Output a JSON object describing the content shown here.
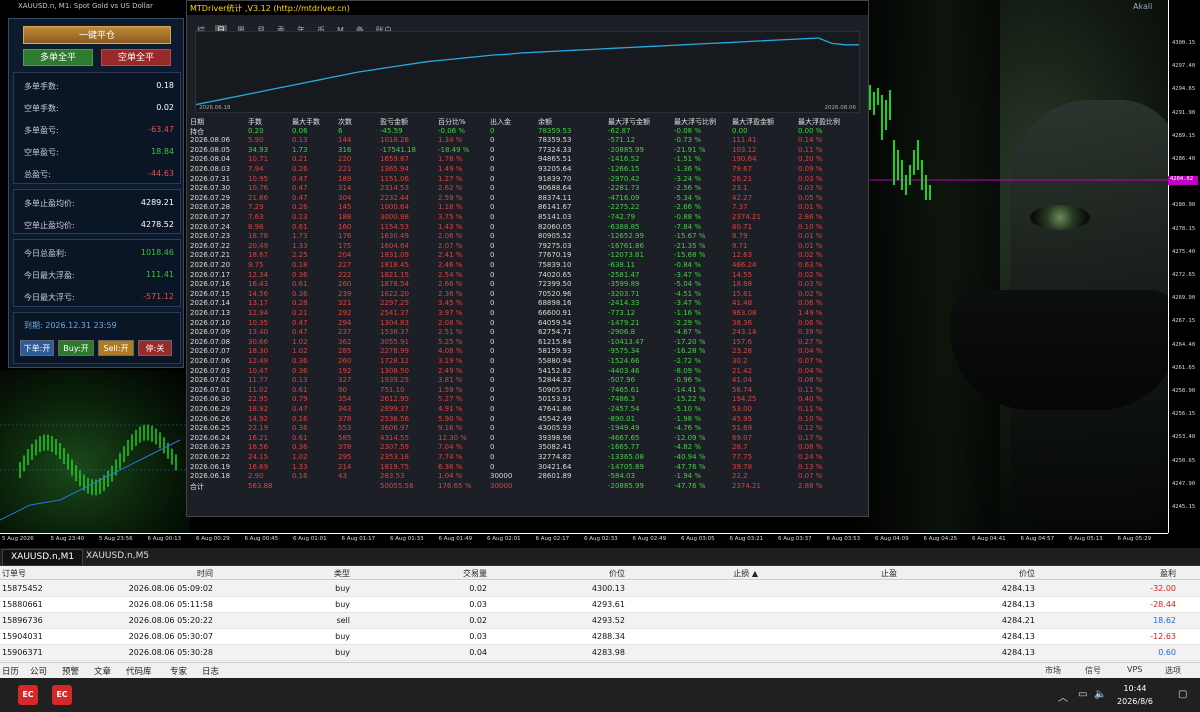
{
  "chart": {
    "title": "XAUUSD.n, M1:  Spot Gold vs US Dollar",
    "user": "Akali",
    "current_price": "4284.62",
    "price_ticks": [
      "4300.15",
      "4297.40",
      "4294.65",
      "4291.90",
      "4289.15",
      "4286.40",
      "4283.65",
      "4280.90",
      "4278.15",
      "4275.40",
      "4272.65",
      "4269.90",
      "4267.15",
      "4264.40",
      "4261.65",
      "4258.90",
      "4256.15",
      "4253.40",
      "4250.65",
      "4247.90",
      "4245.15"
    ],
    "time_ticks": [
      "5 Aug 2026",
      "5 Aug 23:40",
      "5 Aug 23:56",
      "6 Aug 00:13",
      "6 Aug 00:29",
      "6 Aug 00:45",
      "6 Aug 01:01",
      "6 Aug 01:17",
      "6 Aug 01:33",
      "6 Aug 01:49",
      "6 Aug 02:01",
      "6 Aug 02:17",
      "6 Aug 02:33",
      "6 Aug 02:49",
      "6 Aug 03:05",
      "6 Aug 03:21",
      "6 Aug 03:37",
      "6 Aug 03:53",
      "6 Aug 04:09",
      "6 Aug 04:25",
      "6 Aug 04:41",
      "6 Aug 04:57",
      "6 Aug 05:13",
      "6 Aug 05:29"
    ],
    "tabs": [
      "XAUUSD.n,M1",
      "XAUUSD.n,M5"
    ]
  },
  "panel": {
    "close_all": "一键平仓",
    "long_close": "多单全平",
    "short_close": "空单全平",
    "stats1": [
      {
        "label": "多单手数:",
        "value": "0.18",
        "color": "#ffffff"
      },
      {
        "label": "空单手数:",
        "value": "0.02",
        "color": "#ffffff"
      },
      {
        "label": "多单盈亏:",
        "value": "-63.47",
        "color": "#e05050"
      },
      {
        "label": "空单盈亏:",
        "value": "18.84",
        "color": "#40c040"
      },
      {
        "label": "总盈亏:",
        "value": "-44.63",
        "color": "#e05050"
      }
    ],
    "stats2": [
      {
        "label": "多单止盈均价:",
        "value": "4289.21",
        "color": "#ffffff"
      },
      {
        "label": "空单止盈均价:",
        "value": "4278.52",
        "color": "#ffffff"
      }
    ],
    "stats3": [
      {
        "label": "今日总盈利:",
        "value": "1018.46",
        "color": "#40c040"
      },
      {
        "label": "今日最大浮盈:",
        "value": "111.41",
        "color": "#40c040"
      },
      {
        "label": "今日最大浮亏:",
        "value": "-571.12",
        "color": "#e05050"
      }
    ],
    "expiry": "到期: 2026.12.31 23:59",
    "buttons": [
      {
        "label": "下单:开",
        "bg": "#2c5c9a"
      },
      {
        "label": "Buy:开",
        "bg": "#2c7a2c"
      },
      {
        "label": "Sell:开",
        "bg": "#b07a20"
      },
      {
        "label": "停:关",
        "bg": "#9a2a2a"
      }
    ]
  },
  "mtd": {
    "title": "MTDriver统计 ,V3.12 (http://mtdriver.cn)",
    "tabs": [
      "综",
      "日",
      "周",
      "月",
      "季",
      "年",
      "币",
      "M",
      "备",
      "账户"
    ],
    "active_tab": 1,
    "equity_start": "2026.06.18",
    "equity_end": "2026.08.06",
    "equity_curve": [
      0.02,
      0.06,
      0.1,
      0.14,
      0.18,
      0.22,
      0.26,
      0.3,
      0.34,
      0.38,
      0.42,
      0.46,
      0.5,
      0.53,
      0.56,
      0.59,
      0.62,
      0.65,
      0.67,
      0.69,
      0.71,
      0.73,
      0.75,
      0.76,
      0.78,
      0.79,
      0.8,
      0.81,
      0.82,
      0.83,
      0.84,
      0.85,
      0.86,
      0.87,
      0.88,
      0.89,
      0.9,
      0.91,
      0.92,
      0.93,
      0.94,
      0.95,
      0.96,
      0.97,
      0.98,
      0.99,
      1.0,
      0.92,
      0.9,
      0.9
    ],
    "headers": [
      "日期",
      "手数",
      "最大手数",
      "次数",
      "盈亏金额",
      "百分比%",
      "出入金",
      "余额",
      "最大浮亏金额",
      "最大浮亏比例",
      "最大浮盈金额",
      "最大浮盈比例"
    ],
    "hold": [
      "持仓",
      "0.20",
      "0.06",
      "6",
      "-45.59",
      "-0.06 %",
      "0",
      "78359.53",
      "-62.87",
      "-0.08 %",
      "0.00",
      "0.00 %"
    ],
    "rows": [
      [
        "2026.08.06",
        "5.90",
        "0.13",
        "144",
        "1018.26",
        "1.34 %",
        "0",
        "78359.53",
        "-571.12",
        "-0.73 %",
        "111.41",
        "0.14 %"
      ],
      [
        "2026.08.05",
        "34.93",
        "1.73",
        "316",
        "-17541.18",
        "-18.49 %",
        "0",
        "77324.33",
        "-20885.99",
        "-21.91 %",
        "103.12",
        "0.11 %"
      ],
      [
        "2026.08.04",
        "10.71",
        "0.21",
        "220",
        "1659.87",
        "1.78 %",
        "0",
        "94865.51",
        "-1416.52",
        "-1.51 %",
        "190.64",
        "0.20 %"
      ],
      [
        "2026.08.03",
        "7.94",
        "0.26",
        "221",
        "1365.94",
        "1.49 %",
        "0",
        "93205.64",
        "-1266.15",
        "-1.36 %",
        "79.67",
        "0.09 %"
      ],
      [
        "2026.07.31",
        "10.95",
        "0.47",
        "189",
        "1151.06",
        "1.27 %",
        "0",
        "91839.70",
        "-2970.42",
        "-3.24 %",
        "26.21",
        "0.03 %"
      ],
      [
        "2026.07.30",
        "10.76",
        "0.47",
        "314",
        "2314.53",
        "2.62 %",
        "0",
        "90688.64",
        "-2281.73",
        "-2.56 %",
        "23.1",
        "0.03 %"
      ],
      [
        "2026.07.29",
        "21.66",
        "0.47",
        "304",
        "2232.44",
        "2.59 %",
        "0",
        "88374.11",
        "-4716.09",
        "-5.34 %",
        "42.27",
        "0.05 %"
      ],
      [
        "2026.07.28",
        "7.29",
        "0.26",
        "145",
        "1000.64",
        "1.18 %",
        "0",
        "86141.67",
        "-2275.22",
        "-2.66 %",
        "7.37",
        "0.01 %"
      ],
      [
        "2026.07.27",
        "7.63",
        "0.13",
        "188",
        "3000.98",
        "3.75 %",
        "0",
        "85141.03",
        "-742.79",
        "-0.88 %",
        "2374.21",
        "2.86 %"
      ],
      [
        "2026.07.24",
        "8.96",
        "0.61",
        "160",
        "1154.53",
        "1.43 %",
        "0",
        "82060.05",
        "-6388.85",
        "-7.84 %",
        "80.71",
        "0.10 %"
      ],
      [
        "2026.07.23",
        "18.78",
        "1.73",
        "176",
        "1630.49",
        "2.06 %",
        "0",
        "80905.52",
        "-12652.99",
        "-15.67 %",
        "8.79",
        "0.01 %"
      ],
      [
        "2026.07.22",
        "20.49",
        "1.33",
        "175",
        "1604.64",
        "2.07 %",
        "0",
        "79275.03",
        "-16761.86",
        "-21.35 %",
        "9.71",
        "0.01 %"
      ],
      [
        "2026.07.21",
        "18.67",
        "2.25",
        "204",
        "1831.09",
        "2.41 %",
        "0",
        "77670.19",
        "-12073.81",
        "-15.68 %",
        "12.63",
        "0.02 %"
      ],
      [
        "2026.07.20",
        "9.75",
        "0.18",
        "227",
        "1818.45",
        "2.46 %",
        "0",
        "75839.10",
        "-638.11",
        "-0.84 %",
        "466.24",
        "0.63 %"
      ],
      [
        "2026.07.17",
        "12.34",
        "0.36",
        "222",
        "1821.15",
        "2.54 %",
        "0",
        "74020.65",
        "-2581.47",
        "-3.47 %",
        "14.55",
        "0.02 %"
      ],
      [
        "2026.07.16",
        "16.43",
        "0.61",
        "260",
        "1878.54",
        "2.66 %",
        "0",
        "72399.50",
        "-3599.89",
        "-5.04 %",
        "18.68",
        "0.03 %"
      ],
      [
        "2026.07.15",
        "14.56",
        "0.36",
        "239",
        "1622.20",
        "2.36 %",
        "0",
        "70520.96",
        "-3203.71",
        "-4.51 %",
        "15.61",
        "0.02 %"
      ],
      [
        "2026.07.14",
        "13.17",
        "0.28",
        "321",
        "2297.25",
        "3.45 %",
        "0",
        "68898.16",
        "-2414.33",
        "-3.47 %",
        "41.48",
        "0.06 %"
      ],
      [
        "2026.07.13",
        "12.94",
        "0.21",
        "292",
        "2541.37",
        "3.97 %",
        "0",
        "66600.91",
        "-773.12",
        "-1.16 %",
        "963.08",
        "1.49 %"
      ],
      [
        "2026.07.10",
        "10.35",
        "0.47",
        "294",
        "1304.83",
        "2.08 %",
        "0",
        "64059.54",
        "-1479.21",
        "-2.29 %",
        "38.36",
        "0.06 %"
      ],
      [
        "2026.07.09",
        "13.40",
        "0.47",
        "237",
        "1538.37",
        "2.51 %",
        "0",
        "62754.71",
        "-2906.8",
        "-4.67 %",
        "243.14",
        "0.39 %"
      ],
      [
        "2026.07.08",
        "30.66",
        "1.02",
        "362",
        "3055.91",
        "5.25 %",
        "0",
        "61215.84",
        "-10413.47",
        "-17.20 %",
        "157.6",
        "0.27 %"
      ],
      [
        "2026.07.07",
        "18.30",
        "1.02",
        "285",
        "2278.99",
        "4.08 %",
        "0",
        "58159.93",
        "-9575.34",
        "-16.28 %",
        "23.28",
        "0.04 %"
      ],
      [
        "2026.07.06",
        "12.49",
        "0.36",
        "260",
        "1728.12",
        "3.19 %",
        "0",
        "55880.94",
        "-1524.66",
        "-2.72 %",
        "30.2",
        "0.07 %"
      ],
      [
        "2026.07.03",
        "10.47",
        "0.36",
        "192",
        "1308.50",
        "2.49 %",
        "0",
        "54152.82",
        "-4403.46",
        "-8.09 %",
        "21.42",
        "0.04 %"
      ],
      [
        "2026.07.02",
        "11.77",
        "0.13",
        "327",
        "1939.25",
        "3.81 %",
        "0",
        "52844.32",
        "-507.96",
        "-0.96 %",
        "41.04",
        "0.08 %"
      ],
      [
        "2026.07.01",
        "11.02",
        "0.61",
        "90",
        "751.10",
        "1.59 %",
        "0",
        "50905.07",
        "-7465.61",
        "-14.41 %",
        "56.74",
        "0.11 %"
      ],
      [
        "2026.06.30",
        "22.95",
        "0.79",
        "354",
        "2612.95",
        "5.27 %",
        "0",
        "50153.91",
        "-7486.3",
        "-15.22 %",
        "194.25",
        "0.40 %"
      ],
      [
        "2026.06.29",
        "18.92",
        "0.47",
        "343",
        "2899.37",
        "4.91 %",
        "0",
        "47641.86",
        "-2457.54",
        "-5.10 %",
        "53.00",
        "0.11 %"
      ],
      [
        "2026.06.26",
        "14.92",
        "0.16",
        "378",
        "2536.56",
        "5.90 %",
        "0",
        "45542.49",
        "-890.01",
        "-1.98 %",
        "45.95",
        "0.10 %"
      ],
      [
        "2026.06.25",
        "22.19",
        "0.36",
        "553",
        "3606.97",
        "9.16 %",
        "0",
        "43005.93",
        "-1949.49",
        "-4.76 %",
        "51.69",
        "0.12 %"
      ],
      [
        "2026.06.24",
        "16.21",
        "0.61",
        "585",
        "4314.55",
        "12.30 %",
        "0",
        "39398.96",
        "-4667.65",
        "-12.09 %",
        "69.07",
        "0.17 %"
      ],
      [
        "2026.06.23",
        "16.56",
        "0.36",
        "378",
        "2307.59",
        "7.04 %",
        "0",
        "35082.41",
        "-1665.77",
        "-4.82 %",
        "28.7",
        "0.08 %"
      ],
      [
        "2026.06.22",
        "24.15",
        "1.02",
        "295",
        "2353.18",
        "7.74 %",
        "0",
        "32774.82",
        "-13365.08",
        "-40.94 %",
        "77.75",
        "0.24 %"
      ],
      [
        "2026.06.19",
        "16.69",
        "1.33",
        "214",
        "1819.75",
        "6.36 %",
        "0",
        "30421.64",
        "-14705.89",
        "-47.76 %",
        "39.78",
        "0.13 %"
      ],
      [
        "2026.06.18",
        "2.90",
        "0.16",
        "43",
        "283.53",
        "1.04 %",
        "30000",
        "28601.89",
        "-584.03",
        "-1.94 %",
        "22.2",
        "0.07 %"
      ]
    ],
    "total": [
      "合计",
      "563.88",
      "",
      "",
      "50055.58",
      "176.65 %",
      "30000",
      "",
      "-20885.99",
      "-47.76 %",
      "2374.21",
      "2.88 %"
    ]
  },
  "orders": {
    "headers": [
      "订单号",
      "时间",
      "类型",
      "交易量",
      "价位",
      "止损 ▲",
      "止盈",
      "价位",
      "盈利"
    ],
    "rows": [
      {
        "id": "15875452",
        "time": "2026.08.06 05:09:02",
        "type": "buy",
        "vol": "0.02",
        "price": "4300.13",
        "sl": "",
        "tp": "",
        "cur": "4284.13",
        "profit": "-32.00",
        "pcolor": "#d02020"
      },
      {
        "id": "15880661",
        "time": "2026.08.06 05:11:58",
        "type": "buy",
        "vol": "0.03",
        "price": "4293.61",
        "sl": "",
        "tp": "",
        "cur": "4284.13",
        "profit": "-28.44",
        "pcolor": "#d02020"
      },
      {
        "id": "15896736",
        "time": "2026.08.06 05:20:22",
        "type": "sell",
        "vol": "0.02",
        "price": "4293.52",
        "sl": "",
        "tp": "",
        "cur": "4284.21",
        "profit": "18.62",
        "pcolor": "#1a6ad0"
      },
      {
        "id": "15904031",
        "time": "2026.08.06 05:30:07",
        "type": "buy",
        "vol": "0.03",
        "price": "4288.34",
        "sl": "",
        "tp": "",
        "cur": "4284.13",
        "profit": "-12.63",
        "pcolor": "#d02020"
      },
      {
        "id": "15906371",
        "time": "2026.08.06 05:30:28",
        "type": "buy",
        "vol": "0.04",
        "price": "4283.98",
        "sl": "",
        "tp": "",
        "cur": "4284.13",
        "profit": "0.60",
        "pcolor": "#1a6ad0"
      }
    ]
  },
  "terminal_tabs": [
    "日历",
    "公司",
    "预警",
    "文章",
    "代码库",
    "专家",
    "日志"
  ],
  "terminal_right": [
    "市场",
    "信号",
    "VPS",
    "选项"
  ],
  "taskbar": {
    "apps": [
      "EC",
      "EC"
    ],
    "time": "10:44",
    "date": "2026/8/6"
  }
}
